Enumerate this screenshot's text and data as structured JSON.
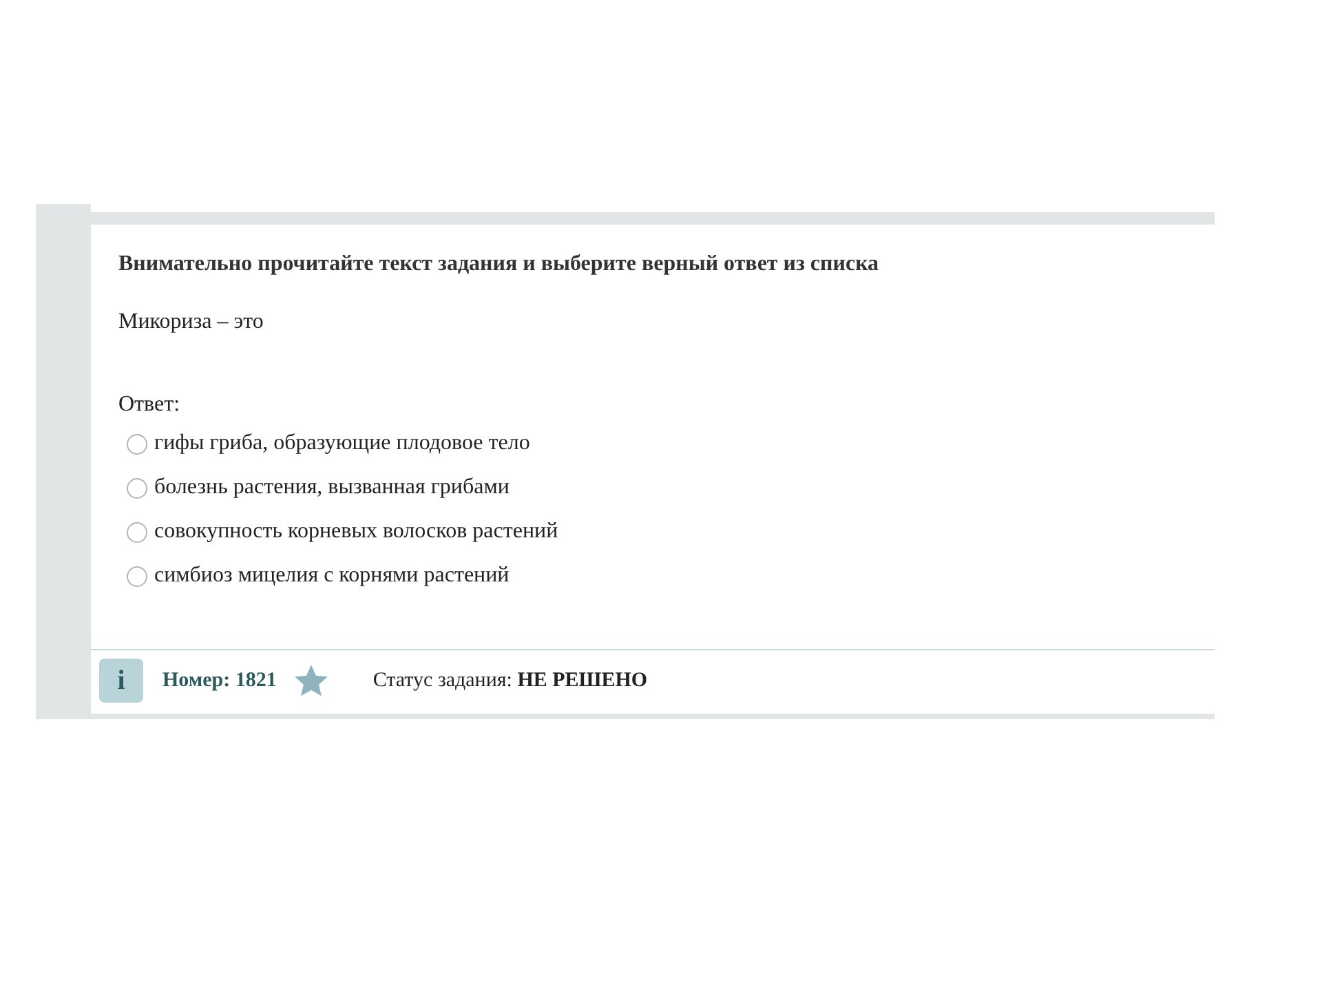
{
  "task": {
    "instruction": "Внимательно прочитайте текст задания и выберите верный ответ из списка",
    "question": "Микориза – это",
    "answer_label": "Ответ:",
    "options": [
      {
        "label": "гифы гриба, образующие плодовое тело",
        "selected": false
      },
      {
        "label": "болезнь растения, вызванная грибами",
        "selected": false
      },
      {
        "label": "совокупность корневых волосков растений",
        "selected": false
      },
      {
        "label": "симбиоз мицелия с корнями растений",
        "selected": false
      }
    ]
  },
  "footer": {
    "info_button": "i",
    "number": "Номер: 1821",
    "status": "Статус задания: **НЕ РЕШЕНО**"
  }
}
